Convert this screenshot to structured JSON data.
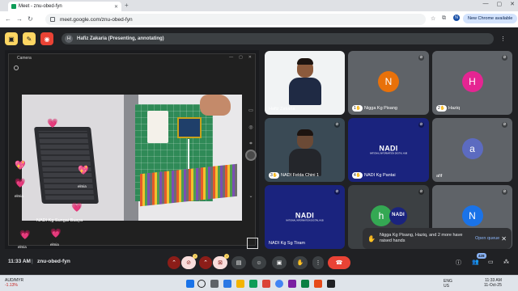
{
  "browser": {
    "tab_title": "Meet - znu-obed-fyn",
    "url": "meet.google.com/znu-obed-fyn",
    "update_label": "New Chrome available",
    "profile_initial": "N"
  },
  "meet_header": {
    "presenter_initial": "H",
    "presenting_text": "Hafiz Zakaria (Presenting, annotating)"
  },
  "camera_window": {
    "title": "Camera"
  },
  "reactions": {
    "labels": [
      "elmia",
      "elmia",
      "elmia",
      "elmia"
    ],
    "caption": "NADI Kg Sungai Buaya"
  },
  "participants": [
    {
      "name": "Hafiz Zakaria",
      "type": "video",
      "bg": "#ffffff"
    },
    {
      "name": "Nigga Kg Pisang",
      "hand_number": "1",
      "initial": "N",
      "bg": "#5f6368",
      "avatar_color": "#e8710a"
    },
    {
      "name": "Haziq",
      "hand_number": "2",
      "initial": "H",
      "bg": "#5f6368",
      "avatar_color": "#e52592"
    },
    {
      "name": "NADI Felda Chini 1",
      "hand_number": "3",
      "type": "video",
      "bg": "#3c4043"
    },
    {
      "name": "NADI Kg Pantai",
      "hand_number": "4",
      "type": "logo",
      "bg": "#1a237e"
    },
    {
      "name": "afif",
      "initial": "a",
      "bg": "#5f6368",
      "avatar_color": "#5c6bc0"
    },
    {
      "name": "NADI Kg Sg Tiram",
      "type": "logo",
      "bg": "#1a237e"
    },
    {
      "name": "",
      "initial": "h",
      "type": "logo",
      "bg": "#3c4043",
      "avatar_color": "#34a853"
    },
    {
      "name": "",
      "initial": "N",
      "bg": "#5f6368",
      "avatar_color": "#1a73e8"
    }
  ],
  "nadi_logo": {
    "text": "NADI",
    "sub": "NATIONAL INFORMATION DIGITAL HUB"
  },
  "notification": {
    "message": "Nigga Kg Pisang, Haziq, and 2 more have raised hands",
    "action": "Open queue"
  },
  "bottom_bar": {
    "time": "11:33 AM",
    "separator": "|",
    "meeting_code": "znu-obed-fyn",
    "people_count": "428"
  },
  "taskbar": {
    "currency": "AUD/MYR",
    "change": "-1.13%",
    "lang": "ENG",
    "region": "US",
    "time": "11:33 AM",
    "date": "11-Oct-25"
  },
  "colors": {
    "meet_bg": "#202124",
    "end_call": "#ea4335",
    "muted_control": "#8c1d18",
    "link": "#8ab4f8"
  }
}
